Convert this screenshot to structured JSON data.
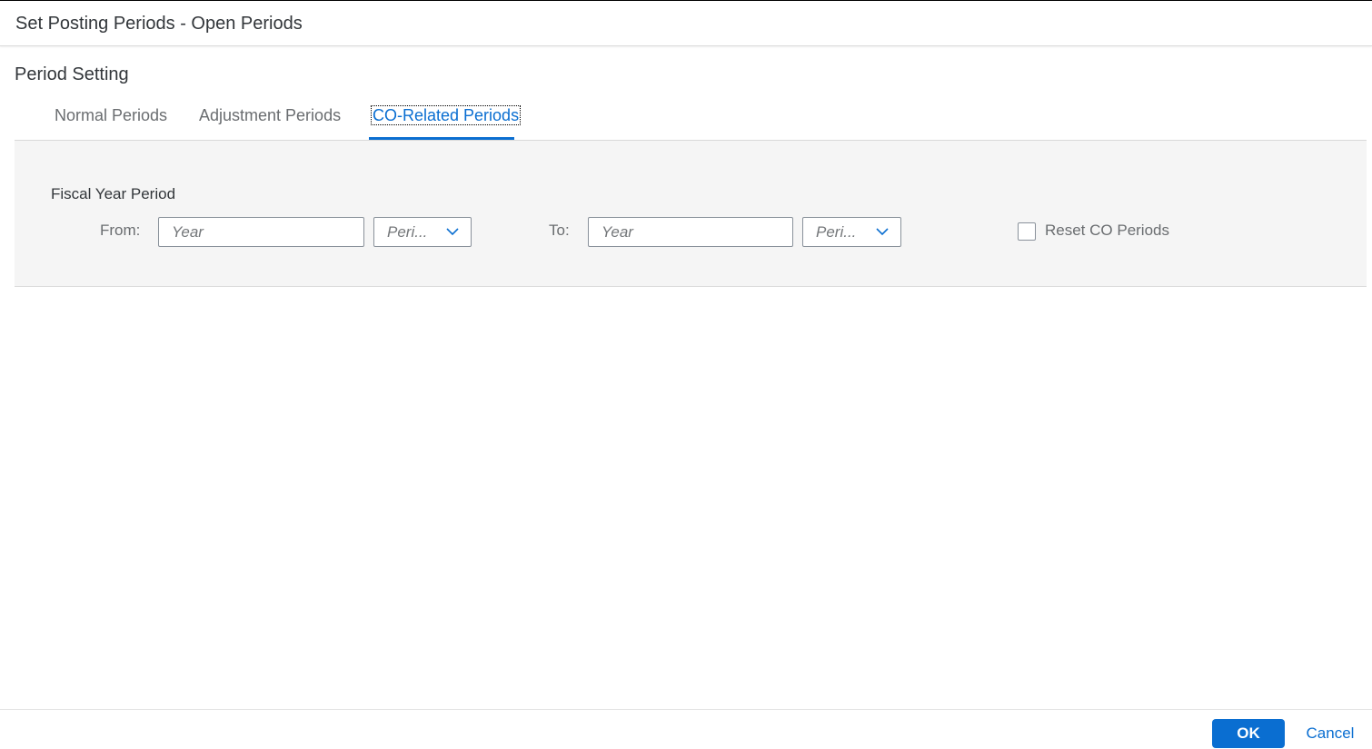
{
  "dialog": {
    "title": "Set Posting Periods - Open Periods"
  },
  "section": {
    "title": "Period Setting"
  },
  "tabs": [
    {
      "label": "Normal Periods",
      "active": false
    },
    {
      "label": "Adjustment Periods",
      "active": false
    },
    {
      "label": "CO-Related Periods",
      "active": true
    }
  ],
  "panel": {
    "group_title": "Fiscal Year Period",
    "from": {
      "label": "From:",
      "year_placeholder": "Year",
      "period_placeholder": "Peri..."
    },
    "to": {
      "label": "To:",
      "year_placeholder": "Year",
      "period_placeholder": "Peri..."
    },
    "reset_checkbox": {
      "label": "Reset CO Periods",
      "checked": false
    }
  },
  "footer": {
    "ok_label": "OK",
    "cancel_label": "Cancel"
  },
  "colors": {
    "accent": "#0a6ed1",
    "panel_background": "#f5f5f5",
    "border": "#89919a"
  },
  "icons": {
    "dropdown": "chevron-down-icon"
  }
}
